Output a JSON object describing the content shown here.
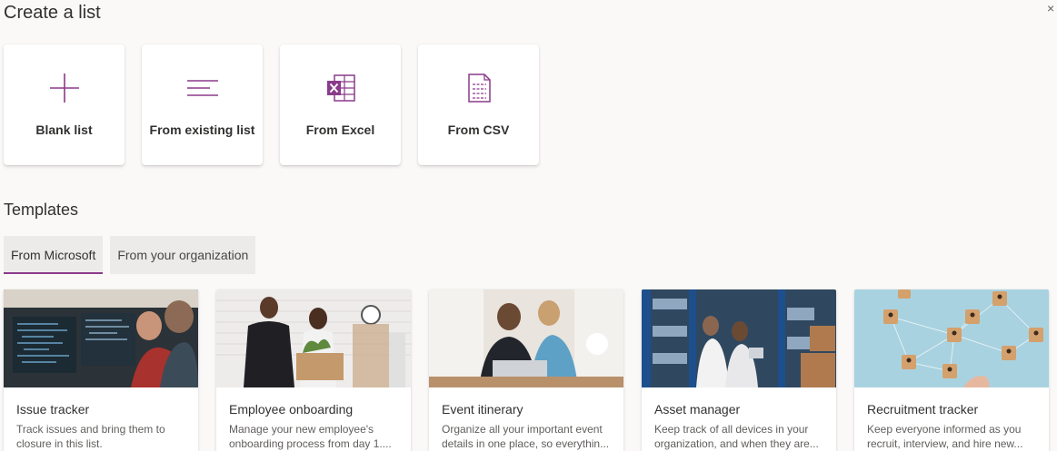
{
  "header": {
    "title": "Create a list",
    "close_glyph": "×"
  },
  "create": [
    {
      "label": "Blank list",
      "icon": "plus-icon"
    },
    {
      "label": "From existing list",
      "icon": "lines-icon"
    },
    {
      "label": "From Excel",
      "icon": "excel-icon"
    },
    {
      "label": "From CSV",
      "icon": "csv-icon"
    }
  ],
  "templates": {
    "title": "Templates",
    "tabs": [
      {
        "label": "From Microsoft",
        "active": true
      },
      {
        "label": "From your organization",
        "active": false
      }
    ],
    "items": [
      {
        "name": "Issue tracker",
        "desc_1": "Track issues and bring them to",
        "desc_2": "closure in this list."
      },
      {
        "name": "Employee onboarding",
        "desc_1": "Manage your new employee's",
        "desc_2": "onboarding process from day 1...."
      },
      {
        "name": "Event itinerary",
        "desc_1": "Organize all your important event",
        "desc_2": "details in one place, so everythin..."
      },
      {
        "name": "Asset manager",
        "desc_1": "Keep track of all devices in your",
        "desc_2": "organization, and when they are..."
      },
      {
        "name": "Recruitment tracker",
        "desc_1": "Keep everyone informed as you",
        "desc_2": "recruit, interview, and hire new..."
      }
    ]
  },
  "colors": {
    "accent": "#8a3a8a",
    "background": "#faf9f8"
  }
}
